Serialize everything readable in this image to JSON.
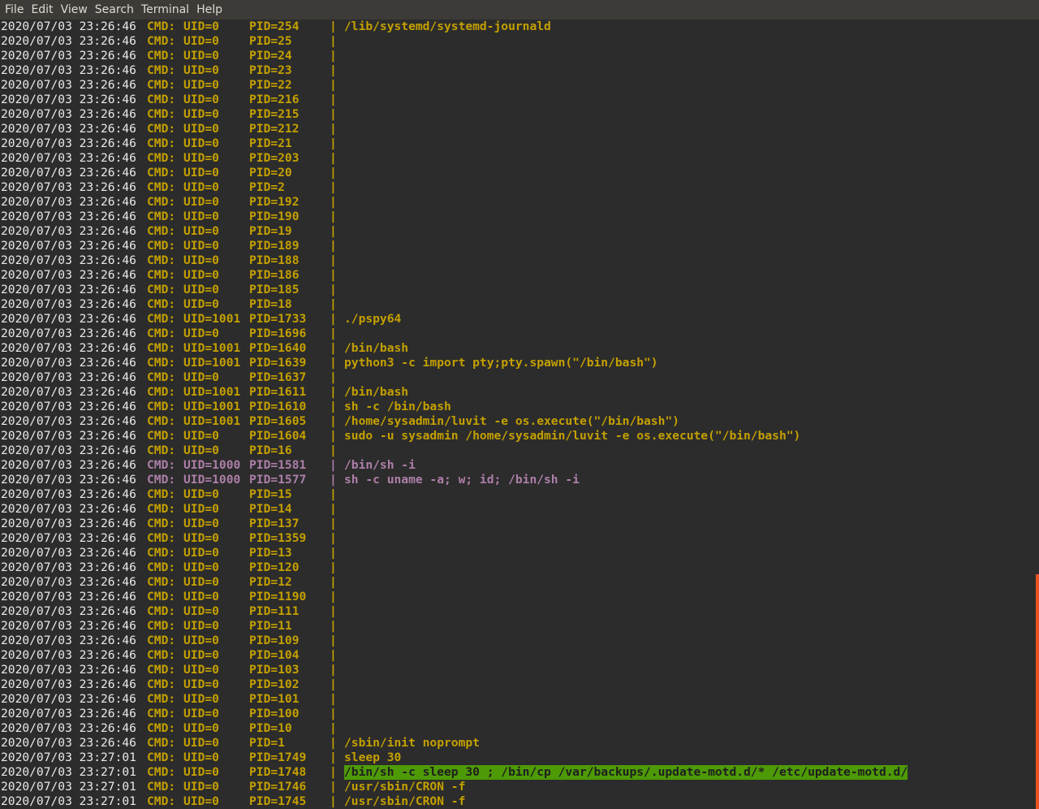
{
  "menubar": {
    "items": [
      "File",
      "Edit",
      "View",
      "Search",
      "Terminal",
      "Help"
    ]
  },
  "colors": {
    "accent_yellow": "#c4a000",
    "accent_purple": "#ad7fa8",
    "highlight": "#4e9a06",
    "scrollbar": "#e95420"
  },
  "lines": [
    {
      "ts": "2020/07/03 23:26:46",
      "cmd": "CMD:",
      "uid": "UID=0",
      "pid": "PID=254",
      "sep": "|",
      "text": "/lib/systemd/systemd-journald",
      "color": "yellow"
    },
    {
      "ts": "2020/07/03 23:26:46",
      "cmd": "CMD:",
      "uid": "UID=0",
      "pid": "PID=25",
      "sep": "|",
      "text": "",
      "color": "yellow"
    },
    {
      "ts": "2020/07/03 23:26:46",
      "cmd": "CMD:",
      "uid": "UID=0",
      "pid": "PID=24",
      "sep": "|",
      "text": "",
      "color": "yellow"
    },
    {
      "ts": "2020/07/03 23:26:46",
      "cmd": "CMD:",
      "uid": "UID=0",
      "pid": "PID=23",
      "sep": "|",
      "text": "",
      "color": "yellow"
    },
    {
      "ts": "2020/07/03 23:26:46",
      "cmd": "CMD:",
      "uid": "UID=0",
      "pid": "PID=22",
      "sep": "|",
      "text": "",
      "color": "yellow"
    },
    {
      "ts": "2020/07/03 23:26:46",
      "cmd": "CMD:",
      "uid": "UID=0",
      "pid": "PID=216",
      "sep": "|",
      "text": "",
      "color": "yellow"
    },
    {
      "ts": "2020/07/03 23:26:46",
      "cmd": "CMD:",
      "uid": "UID=0",
      "pid": "PID=215",
      "sep": "|",
      "text": "",
      "color": "yellow"
    },
    {
      "ts": "2020/07/03 23:26:46",
      "cmd": "CMD:",
      "uid": "UID=0",
      "pid": "PID=212",
      "sep": "|",
      "text": "",
      "color": "yellow"
    },
    {
      "ts": "2020/07/03 23:26:46",
      "cmd": "CMD:",
      "uid": "UID=0",
      "pid": "PID=21",
      "sep": "|",
      "text": "",
      "color": "yellow"
    },
    {
      "ts": "2020/07/03 23:26:46",
      "cmd": "CMD:",
      "uid": "UID=0",
      "pid": "PID=203",
      "sep": "|",
      "text": "",
      "color": "yellow"
    },
    {
      "ts": "2020/07/03 23:26:46",
      "cmd": "CMD:",
      "uid": "UID=0",
      "pid": "PID=20",
      "sep": "|",
      "text": "",
      "color": "yellow"
    },
    {
      "ts": "2020/07/03 23:26:46",
      "cmd": "CMD:",
      "uid": "UID=0",
      "pid": "PID=2",
      "sep": "|",
      "text": "",
      "color": "yellow"
    },
    {
      "ts": "2020/07/03 23:26:46",
      "cmd": "CMD:",
      "uid": "UID=0",
      "pid": "PID=192",
      "sep": "|",
      "text": "",
      "color": "yellow"
    },
    {
      "ts": "2020/07/03 23:26:46",
      "cmd": "CMD:",
      "uid": "UID=0",
      "pid": "PID=190",
      "sep": "|",
      "text": "",
      "color": "yellow"
    },
    {
      "ts": "2020/07/03 23:26:46",
      "cmd": "CMD:",
      "uid": "UID=0",
      "pid": "PID=19",
      "sep": "|",
      "text": "",
      "color": "yellow"
    },
    {
      "ts": "2020/07/03 23:26:46",
      "cmd": "CMD:",
      "uid": "UID=0",
      "pid": "PID=189",
      "sep": "|",
      "text": "",
      "color": "yellow"
    },
    {
      "ts": "2020/07/03 23:26:46",
      "cmd": "CMD:",
      "uid": "UID=0",
      "pid": "PID=188",
      "sep": "|",
      "text": "",
      "color": "yellow"
    },
    {
      "ts": "2020/07/03 23:26:46",
      "cmd": "CMD:",
      "uid": "UID=0",
      "pid": "PID=186",
      "sep": "|",
      "text": "",
      "color": "yellow"
    },
    {
      "ts": "2020/07/03 23:26:46",
      "cmd": "CMD:",
      "uid": "UID=0",
      "pid": "PID=185",
      "sep": "|",
      "text": "",
      "color": "yellow"
    },
    {
      "ts": "2020/07/03 23:26:46",
      "cmd": "CMD:",
      "uid": "UID=0",
      "pid": "PID=18",
      "sep": "|",
      "text": "",
      "color": "yellow"
    },
    {
      "ts": "2020/07/03 23:26:46",
      "cmd": "CMD:",
      "uid": "UID=1001",
      "pid": "PID=1733",
      "sep": "|",
      "text": "./pspy64",
      "color": "yellow"
    },
    {
      "ts": "2020/07/03 23:26:46",
      "cmd": "CMD:",
      "uid": "UID=0",
      "pid": "PID=1696",
      "sep": "|",
      "text": "",
      "color": "yellow"
    },
    {
      "ts": "2020/07/03 23:26:46",
      "cmd": "CMD:",
      "uid": "UID=1001",
      "pid": "PID=1640",
      "sep": "|",
      "text": "/bin/bash",
      "color": "yellow"
    },
    {
      "ts": "2020/07/03 23:26:46",
      "cmd": "CMD:",
      "uid": "UID=1001",
      "pid": "PID=1639",
      "sep": "|",
      "text": "python3 -c import pty;pty.spawn(\"/bin/bash\")",
      "color": "yellow"
    },
    {
      "ts": "2020/07/03 23:26:46",
      "cmd": "CMD:",
      "uid": "UID=0",
      "pid": "PID=1637",
      "sep": "|",
      "text": "",
      "color": "yellow"
    },
    {
      "ts": "2020/07/03 23:26:46",
      "cmd": "CMD:",
      "uid": "UID=1001",
      "pid": "PID=1611",
      "sep": "|",
      "text": "/bin/bash",
      "color": "yellow"
    },
    {
      "ts": "2020/07/03 23:26:46",
      "cmd": "CMD:",
      "uid": "UID=1001",
      "pid": "PID=1610",
      "sep": "|",
      "text": "sh -c /bin/bash",
      "color": "yellow"
    },
    {
      "ts": "2020/07/03 23:26:46",
      "cmd": "CMD:",
      "uid": "UID=1001",
      "pid": "PID=1605",
      "sep": "|",
      "text": "/home/sysadmin/luvit -e os.execute(\"/bin/bash\")",
      "color": "yellow"
    },
    {
      "ts": "2020/07/03 23:26:46",
      "cmd": "CMD:",
      "uid": "UID=0",
      "pid": "PID=1604",
      "sep": "|",
      "text": "sudo -u sysadmin /home/sysadmin/luvit -e os.execute(\"/bin/bash\")",
      "color": "yellow"
    },
    {
      "ts": "2020/07/03 23:26:46",
      "cmd": "CMD:",
      "uid": "UID=0",
      "pid": "PID=16",
      "sep": "|",
      "text": "",
      "color": "yellow"
    },
    {
      "ts": "2020/07/03 23:26:46",
      "cmd": "CMD:",
      "uid": "UID=1000",
      "pid": "PID=1581",
      "sep": "|",
      "text": "/bin/sh -i",
      "color": "purple"
    },
    {
      "ts": "2020/07/03 23:26:46",
      "cmd": "CMD:",
      "uid": "UID=1000",
      "pid": "PID=1577",
      "sep": "|",
      "text": "sh -c uname -a; w; id; /bin/sh -i",
      "color": "purple"
    },
    {
      "ts": "2020/07/03 23:26:46",
      "cmd": "CMD:",
      "uid": "UID=0",
      "pid": "PID=15",
      "sep": "|",
      "text": "",
      "color": "yellow"
    },
    {
      "ts": "2020/07/03 23:26:46",
      "cmd": "CMD:",
      "uid": "UID=0",
      "pid": "PID=14",
      "sep": "|",
      "text": "",
      "color": "yellow"
    },
    {
      "ts": "2020/07/03 23:26:46",
      "cmd": "CMD:",
      "uid": "UID=0",
      "pid": "PID=137",
      "sep": "|",
      "text": "",
      "color": "yellow"
    },
    {
      "ts": "2020/07/03 23:26:46",
      "cmd": "CMD:",
      "uid": "UID=0",
      "pid": "PID=1359",
      "sep": "|",
      "text": "",
      "color": "yellow"
    },
    {
      "ts": "2020/07/03 23:26:46",
      "cmd": "CMD:",
      "uid": "UID=0",
      "pid": "PID=13",
      "sep": "|",
      "text": "",
      "color": "yellow"
    },
    {
      "ts": "2020/07/03 23:26:46",
      "cmd": "CMD:",
      "uid": "UID=0",
      "pid": "PID=120",
      "sep": "|",
      "text": "",
      "color": "yellow"
    },
    {
      "ts": "2020/07/03 23:26:46",
      "cmd": "CMD:",
      "uid": "UID=0",
      "pid": "PID=12",
      "sep": "|",
      "text": "",
      "color": "yellow"
    },
    {
      "ts": "2020/07/03 23:26:46",
      "cmd": "CMD:",
      "uid": "UID=0",
      "pid": "PID=1190",
      "sep": "|",
      "text": "",
      "color": "yellow"
    },
    {
      "ts": "2020/07/03 23:26:46",
      "cmd": "CMD:",
      "uid": "UID=0",
      "pid": "PID=111",
      "sep": "|",
      "text": "",
      "color": "yellow"
    },
    {
      "ts": "2020/07/03 23:26:46",
      "cmd": "CMD:",
      "uid": "UID=0",
      "pid": "PID=11",
      "sep": "|",
      "text": "",
      "color": "yellow"
    },
    {
      "ts": "2020/07/03 23:26:46",
      "cmd": "CMD:",
      "uid": "UID=0",
      "pid": "PID=109",
      "sep": "|",
      "text": "",
      "color": "yellow"
    },
    {
      "ts": "2020/07/03 23:26:46",
      "cmd": "CMD:",
      "uid": "UID=0",
      "pid": "PID=104",
      "sep": "|",
      "text": "",
      "color": "yellow"
    },
    {
      "ts": "2020/07/03 23:26:46",
      "cmd": "CMD:",
      "uid": "UID=0",
      "pid": "PID=103",
      "sep": "|",
      "text": "",
      "color": "yellow"
    },
    {
      "ts": "2020/07/03 23:26:46",
      "cmd": "CMD:",
      "uid": "UID=0",
      "pid": "PID=102",
      "sep": "|",
      "text": "",
      "color": "yellow"
    },
    {
      "ts": "2020/07/03 23:26:46",
      "cmd": "CMD:",
      "uid": "UID=0",
      "pid": "PID=101",
      "sep": "|",
      "text": "",
      "color": "yellow"
    },
    {
      "ts": "2020/07/03 23:26:46",
      "cmd": "CMD:",
      "uid": "UID=0",
      "pid": "PID=100",
      "sep": "|",
      "text": "",
      "color": "yellow"
    },
    {
      "ts": "2020/07/03 23:26:46",
      "cmd": "CMD:",
      "uid": "UID=0",
      "pid": "PID=10",
      "sep": "|",
      "text": "",
      "color": "yellow"
    },
    {
      "ts": "2020/07/03 23:26:46",
      "cmd": "CMD:",
      "uid": "UID=0",
      "pid": "PID=1",
      "sep": "|",
      "text": "/sbin/init noprompt",
      "color": "yellow"
    },
    {
      "ts": "2020/07/03 23:27:01",
      "cmd": "CMD:",
      "uid": "UID=0",
      "pid": "PID=1749",
      "sep": "|",
      "text": "sleep 30",
      "color": "yellow"
    },
    {
      "ts": "2020/07/03 23:27:01",
      "cmd": "CMD:",
      "uid": "UID=0",
      "pid": "PID=1748",
      "sep": "|",
      "text": "/bin/sh -c sleep 30 ; /bin/cp /var/backups/.update-motd.d/* /etc/update-motd.d/",
      "color": "yellow",
      "highlight": true
    },
    {
      "ts": "2020/07/03 23:27:01",
      "cmd": "CMD:",
      "uid": "UID=0",
      "pid": "PID=1746",
      "sep": "|",
      "text": "/usr/sbin/CRON -f",
      "color": "yellow"
    },
    {
      "ts": "2020/07/03 23:27:01",
      "cmd": "CMD:",
      "uid": "UID=0",
      "pid": "PID=1745",
      "sep": "|",
      "text": "/usr/sbin/CRON -f",
      "color": "yellow"
    }
  ]
}
